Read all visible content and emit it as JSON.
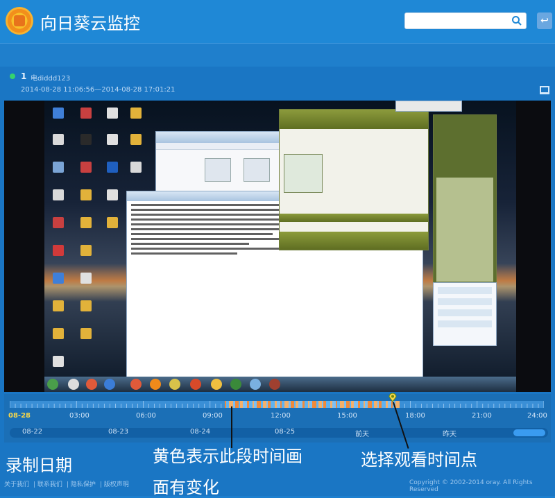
{
  "app": {
    "title": "向日葵云监控"
  },
  "search": {
    "placeholder": ""
  },
  "device": {
    "number": "1",
    "name": "电diddd123",
    "range": "2014-08-28 11:06:56—2014-08-28 17:01:21"
  },
  "timeline": {
    "labels": [
      "08-28",
      "03:00",
      "06:00",
      "09:00",
      "12:00",
      "15:00",
      "18:00",
      "21:00",
      "24:00"
    ],
    "dates": [
      "08-22",
      "08-23",
      "08-24",
      "08-25",
      "前天",
      "昨天"
    ],
    "selected_time_fraction": 0.72
  },
  "annotations": {
    "record_date": "录制日期",
    "yellow_line1": "黄色表示此段时间画",
    "yellow_line2": "面有变化",
    "select_time": "选择观看时间点"
  },
  "footer": {
    "links": [
      "关于我们",
      "联系我们",
      "隐私保护",
      "版权声明"
    ],
    "copyright": "Copyright © 2002-2014 oray. All Rights Reserved"
  },
  "colors": {
    "brand": "#1f88d6",
    "accent_yellow": "#f7d74a",
    "activity_orange": "#f08a3a",
    "activity_blue": "#5fb3f2"
  }
}
